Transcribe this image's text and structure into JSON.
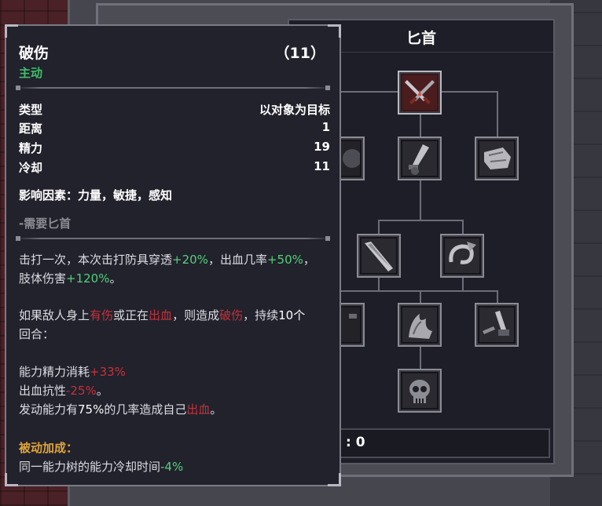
{
  "tree": {
    "title": "匕首",
    "points_text": ": 0"
  },
  "tooltip": {
    "skill_name": "破伤",
    "level": "（11）",
    "kind": "主动",
    "stats": [
      {
        "label": "类型",
        "value": "以对象为目标"
      },
      {
        "label": "距离",
        "value": "1"
      },
      {
        "label": "精力",
        "value": "19"
      },
      {
        "label": "冷却",
        "value": "11"
      }
    ],
    "factors": "影响因素：力量，敏捷，感知",
    "requirement": "-需要匕首",
    "desc1": {
      "a": "击打一次，本次击打防具穿透",
      "b": "+20%",
      "c": "，出血几率",
      "d": "+50%",
      "e": "，",
      "f": "肢体伤害",
      "g": "+120%",
      "h": "。"
    },
    "desc2": {
      "a": "如果敌人身上",
      "b": "有伤",
      "c": "或正在",
      "d": "出血",
      "e": "，则造成",
      "f": "破伤",
      "g": "，持续",
      "h": "10个",
      "i": "回合："
    },
    "desc3": {
      "l1a": "能力精力消耗",
      "l1b": "+33%",
      "l2a": "出血抗性",
      "l2b": "-25%",
      "l2c": "。",
      "l3a": "发动能力有",
      "l3b": "75%",
      "l3c": "的几率造成自己",
      "l3d": "出血",
      "l3e": "。"
    },
    "passive_title": "被动加成：",
    "passive": {
      "a": "同一能力树的能力冷却时间",
      "b": "-4%"
    }
  },
  "colors": {
    "active_green": "#3fbf6a",
    "bonus_green": "#55d07a",
    "penalty_red": "#c7313a",
    "passive_gold": "#e2a43a"
  }
}
